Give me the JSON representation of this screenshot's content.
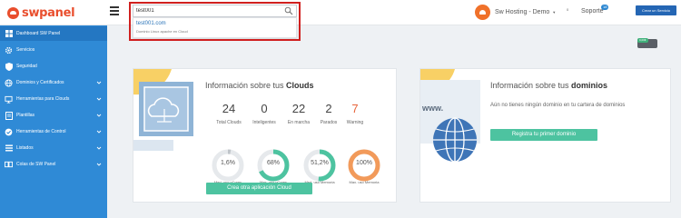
{
  "brand": {
    "name": "swpanel",
    "accent": "#e94e2d"
  },
  "search": {
    "value": "test001",
    "placeholder": ""
  },
  "search_results": [
    {
      "title": "test001.com",
      "subtitle": "Dominio Linux apache en Cloud"
    }
  ],
  "account": {
    "name": "Sw Hosting - Demo",
    "badge": "0"
  },
  "support": {
    "label": "Soporte",
    "badge": "18"
  },
  "new_service_label": "Crear un Servicio",
  "balance": {
    "tag": "0,00€"
  },
  "sidebar": {
    "items": [
      {
        "label": "Dashboard SW Panel",
        "icon": "dashboard-icon",
        "active": true
      },
      {
        "label": "Servicios",
        "icon": "gear-icon"
      },
      {
        "label": "Seguridad",
        "icon": "shield-icon"
      },
      {
        "label": "Dominios y Certificados",
        "icon": "globe-icon"
      },
      {
        "label": "Herramientas para Clouds",
        "icon": "cloud-tools-icon"
      },
      {
        "label": "Plantillas",
        "icon": "template-icon"
      },
      {
        "label": "Herramientas de Control",
        "icon": "check-icon"
      },
      {
        "label": "Listados",
        "icon": "list-icon"
      },
      {
        "label": "Colas de SW Panel",
        "icon": "queue-icon"
      }
    ]
  },
  "clouds": {
    "title_prefix": "Información sobre tus ",
    "title_bold": "Clouds",
    "stats": [
      {
        "value": "24",
        "label": "Total Clouds",
        "color": "#444444"
      },
      {
        "value": "0",
        "label": "Inteligentes",
        "color": "#444444"
      },
      {
        "value": "22",
        "label": "En marcha",
        "color": "#444444"
      },
      {
        "value": "2",
        "label": "Parados",
        "color": "#444444"
      },
      {
        "value": "7",
        "label": "Warning",
        "color": "#e8643a"
      }
    ],
    "gauges": [
      {
        "value": "1,6%",
        "label": "Med. uso vCores",
        "fraction": 0.016,
        "color": "#bfc4c9"
      },
      {
        "value": "68%",
        "label": "Max. uso vCores",
        "fraction": 0.68,
        "color": "#4dc3a0"
      },
      {
        "value": "51,2%",
        "label": "Med. uso Memoria",
        "fraction": 0.512,
        "color": "#4dc3a0"
      },
      {
        "value": "100%",
        "label": "Max. uso Memoria",
        "fraction": 1.0,
        "color": "#f29a5a"
      }
    ],
    "button": "Crea otra aplicación Cloud"
  },
  "domains": {
    "title_prefix": "Información sobre tus ",
    "title_bold": "dominios",
    "empty_text": "Aún no tienes ningún dominio en tu cartera de dominios",
    "button": "Registra tu primer dominio",
    "www_label": "www."
  },
  "colors": {
    "sidebar": "#2f8ad6",
    "sidebar_active": "#2477c2",
    "primary_button": "#2466b4",
    "green_button": "#4dc3a0",
    "highlight": "#d0201f"
  }
}
